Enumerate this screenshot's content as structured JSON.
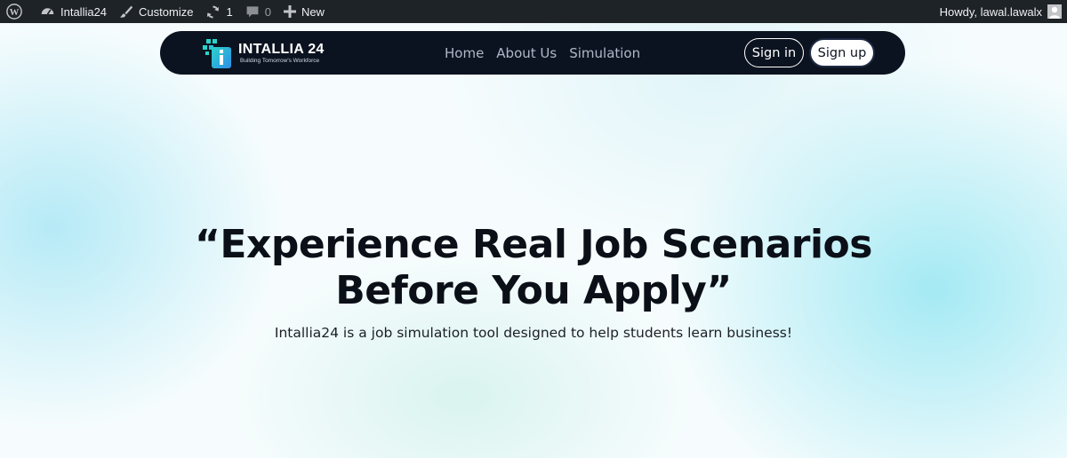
{
  "adminbar": {
    "items": [
      {
        "icon": "wordpress-logo-icon"
      },
      {
        "icon": "dashboard-icon",
        "label": "Intallia24"
      },
      {
        "icon": "brush-icon",
        "label": "Customize"
      },
      {
        "icon": "updates-icon",
        "count": "1"
      },
      {
        "icon": "comments-icon",
        "count": "0"
      },
      {
        "icon": "plus-icon",
        "label": "New"
      }
    ],
    "greeting": "Howdy, lawal.lawalx"
  },
  "nav": {
    "logo_name": "INTALLIA 24",
    "logo_tagline": "Building Tomorrow's Workforce",
    "links": [
      "Home",
      "About Us",
      "Simulation"
    ],
    "signin_label": "Sign in",
    "signup_label": "Sign up"
  },
  "hero": {
    "headline_line1": "“Experience Real Job Scenarios",
    "headline_line2": "Before You Apply”",
    "subtitle": "Intallia24 is a job simulation tool designed to help students learn business!"
  },
  "colors": {
    "adminbar_bg": "#1d2327",
    "navbar_bg": "#0c1320",
    "logo_teal": "#2ad3c9",
    "logo_blue": "#2f8dea"
  }
}
